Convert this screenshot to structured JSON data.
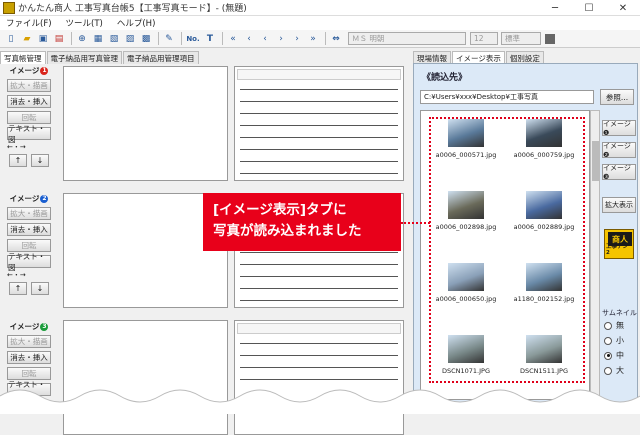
{
  "window": {
    "title": "かんたん商人 工事写真台帳5【工事写真モード】- (無題)",
    "minimize": "─",
    "maximize": "☐",
    "close": "✕"
  },
  "menu": [
    "ファイル(F)",
    "ツール(T)",
    "ヘルプ(H)"
  ],
  "toolbar": {
    "icons": [
      "new-icon",
      "open-icon",
      "save-icon",
      "print-icon",
      "separator",
      "zoom-in-icon",
      "image-icon",
      "photo-icon",
      "layout-icon",
      "printer-icon",
      "separator",
      "edit-icon",
      "separator",
      "number-icon",
      "text-icon",
      "separator",
      "first-page-icon",
      "prev-page-icon",
      "prev-icon",
      "next-icon",
      "next-page-icon",
      "last-page-icon",
      "separator",
      "fit-icon"
    ],
    "number_label": "No.",
    "font_value": "ＭＳ 明朝",
    "size_value": "12",
    "style_value": "標準",
    "color": "#666666"
  },
  "left_tabs": [
    {
      "label": "写真帳管理",
      "active": true
    },
    {
      "label": "電子納品用写真管理",
      "active": false
    },
    {
      "label": "電子納品用管理項目",
      "active": false
    }
  ],
  "image_groups": [
    {
      "label": "イメージ",
      "num": "1",
      "color": "#d9241c"
    },
    {
      "label": "イメージ",
      "num": "2",
      "color": "#1a5fd0"
    },
    {
      "label": "イメージ",
      "num": "3",
      "color": "#1a9c3a"
    }
  ],
  "side_buttons": {
    "zoom": "拡大・描画",
    "erase_insert": "消去・挿入",
    "rotate": "回転",
    "text_figure": "テキスト・図",
    "lr": "←・→",
    "up": "↑",
    "down": "↓"
  },
  "right_tabs": [
    {
      "label": "現場情報",
      "active": false
    },
    {
      "label": "イメージ表示",
      "active": true
    },
    {
      "label": "個別設定",
      "active": false
    }
  ],
  "read_panel": {
    "title": "《読込先》",
    "path": "C:¥Users¥xxx¥Desktop¥工事写真",
    "browse": "参照..."
  },
  "thumbnails": [
    {
      "name": "a0006_000571.jpg",
      "color": "#5a7a9a"
    },
    {
      "name": "a0006_000759.jpg",
      "color": "#3a4a5a"
    },
    {
      "name": "a0006_002898.jpg",
      "color": "#6a6a5a"
    },
    {
      "name": "a0006_002889.jpg",
      "color": "#4a6aa0"
    },
    {
      "name": "a0006_000650.jpg",
      "color": "#8aa0b8"
    },
    {
      "name": "a1180_002152.jpg",
      "color": "#6a8aa8"
    },
    {
      "name": "DSCN1071.JPG",
      "color": "#7a8a8a"
    },
    {
      "name": "DSCN1511.JPG",
      "color": "#8a9a9a"
    }
  ],
  "right_side_buttons": {
    "image1": "イメージ❶",
    "image2": "イメージ❷",
    "image3": "イメージ❸",
    "zoom_display": "拡大表示"
  },
  "logo": {
    "main": "商人",
    "sub": "工事デジ 2"
  },
  "thumbnail_size": {
    "label": "サムネイル",
    "options": [
      "無",
      "小",
      "中",
      "大"
    ],
    "selected": "中"
  },
  "callout": {
    "line1": "[イメージ表示]タブに",
    "line2": "写真が読み込まれました"
  }
}
